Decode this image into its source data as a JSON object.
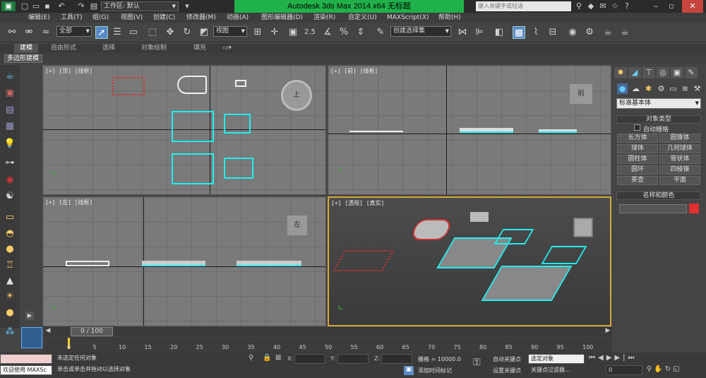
{
  "app": {
    "title": "Autodesk 3ds Max  2014 x64     无标题",
    "workspace": "工作区: 默认",
    "help_search_placeholder": "键入关键字或短语"
  },
  "menu": [
    "编辑(E)",
    "工具(T)",
    "组(G)",
    "视图(V)",
    "创建(C)",
    "修改器(M)",
    "动画(A)",
    "图形编辑器(D)",
    "渲染(R)",
    "自定义(U)",
    "MAXScript(X)",
    "帮助(H)"
  ],
  "toolbar": {
    "selection_filter": "全部",
    "reference_coord": "视图",
    "snap_angle": "2.5",
    "named_selection": "创建选择集"
  },
  "ribbon": {
    "tabs": [
      "建模",
      "自由形式",
      "选择",
      "对象绘制",
      "填充"
    ],
    "active_tab": "建模",
    "panel_label": "多边形建模"
  },
  "viewports": {
    "top": "[+] [顶] [线框]",
    "front": "[+] [前] [线框]",
    "left": "[+] [左] [线框]",
    "perspective": "[+] [透视] [真实]",
    "viewcube_top": "上",
    "viewcube_front": "前",
    "viewcube_left": "左"
  },
  "command_panel": {
    "category": "标准基本体",
    "object_type_title": "对象类型",
    "autogrid": "自动栅格",
    "buttons": [
      "长方体",
      "圆锥体",
      "球体",
      "几何球体",
      "圆柱体",
      "管状体",
      "圆环",
      "四棱锥",
      "茶壶",
      "平面"
    ],
    "name_color_title": "名称和颜色",
    "swatch_color": "#e03030"
  },
  "timeline": {
    "frame": "0 / 100",
    "ticks": [
      "0",
      "5",
      "10",
      "15",
      "20",
      "25",
      "30",
      "35",
      "40",
      "45",
      "50",
      "55",
      "60",
      "65",
      "70",
      "75",
      "80",
      "85",
      "90",
      "95",
      "100"
    ]
  },
  "status": {
    "welcome": "欢迎使用 MAXSc",
    "no_selection": "未选定任何对象",
    "prompt": "单击或单击并拖动以选择对象",
    "x_label": "X:",
    "y_label": "Y:",
    "z_label": "Z:",
    "grid": "栅格 = 10000.0",
    "auto_key": "自动关键点",
    "set_key": "设置关键点",
    "selected_object": "选定对象",
    "key_filters": "关键点过滤器...",
    "add_time_tag": "添加时间标记",
    "frame_input": "0"
  }
}
